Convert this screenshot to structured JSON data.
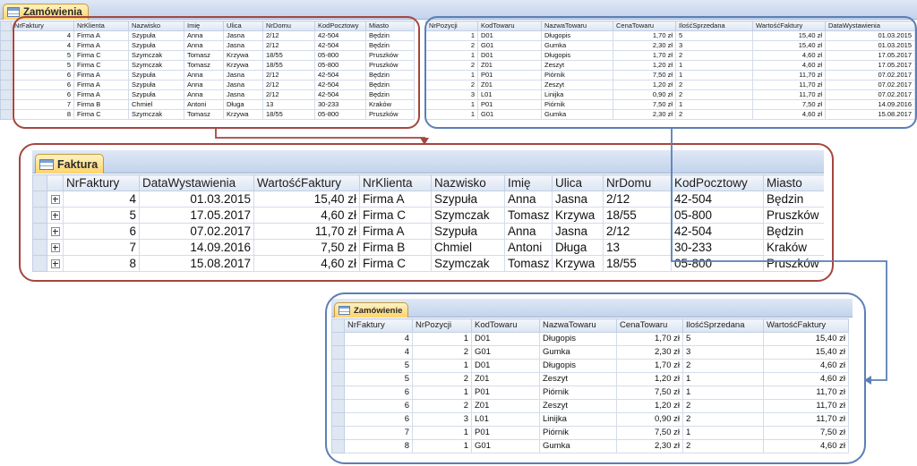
{
  "colors": {
    "red_outline": "#a5463f",
    "blue_outline": "#5b7fb5",
    "tab_fill": "#ffd36b",
    "header_fill": "#dbe5f3"
  },
  "icons": {
    "table": "table-icon",
    "expand": "plus-box-icon"
  },
  "orders_table": {
    "title": "Zamówienia",
    "columns": [
      "NrFaktury",
      "NrKlienta",
      "Nazwisko",
      "Imię",
      "Ulica",
      "NrDomu",
      "KodPocztowy",
      "Miasto"
    ],
    "rows": [
      [
        "4",
        "Firma A",
        "Szypuła",
        "Anna",
        "Jasna",
        "2/12",
        "42-504",
        "Będzin"
      ],
      [
        "4",
        "Firma A",
        "Szypuła",
        "Anna",
        "Jasna",
        "2/12",
        "42-504",
        "Będzin"
      ],
      [
        "5",
        "Firma C",
        "Szymczak",
        "Tomasz",
        "Krzywa",
        "18/55",
        "05-800",
        "Pruszków"
      ],
      [
        "5",
        "Firma C",
        "Szymczak",
        "Tomasz",
        "Krzywa",
        "18/55",
        "05-800",
        "Pruszków"
      ],
      [
        "6",
        "Firma A",
        "Szypuła",
        "Anna",
        "Jasna",
        "2/12",
        "42-504",
        "Będzin"
      ],
      [
        "6",
        "Firma A",
        "Szypuła",
        "Anna",
        "Jasna",
        "2/12",
        "42-504",
        "Będzin"
      ],
      [
        "6",
        "Firma A",
        "Szypuła",
        "Anna",
        "Jasna",
        "2/12",
        "42-504",
        "Będzin"
      ],
      [
        "7",
        "Firma B",
        "Chmiel",
        "Antoni",
        "Długa",
        "13",
        "30-233",
        "Kraków"
      ],
      [
        "8",
        "Firma C",
        "Szymczak",
        "Tomasz",
        "Krzywa",
        "18/55",
        "05-800",
        "Pruszków"
      ]
    ]
  },
  "positions_table": {
    "columns": [
      "NrPozycji",
      "KodTowaru",
      "NazwaTowaru",
      "CenaTowaru",
      "IlośćSprzedana",
      "WartośćFaktury",
      "DataWystawienia"
    ],
    "rows": [
      [
        "1",
        "D01",
        "Długopis",
        "1,70 zł",
        "5",
        "15,40 zł",
        "01.03.2015"
      ],
      [
        "2",
        "G01",
        "Gumka",
        "2,30 zł",
        "3",
        "15,40 zł",
        "01.03.2015"
      ],
      [
        "1",
        "D01",
        "Długopis",
        "1,70 zł",
        "2",
        "4,60 zł",
        "17.05.2017"
      ],
      [
        "2",
        "Z01",
        "Zeszyt",
        "1,20 zł",
        "1",
        "4,60 zł",
        "17.05.2017"
      ],
      [
        "1",
        "P01",
        "Piórnik",
        "7,50 zł",
        "1",
        "11,70 zł",
        "07.02.2017"
      ],
      [
        "2",
        "Z01",
        "Zeszyt",
        "1,20 zł",
        "2",
        "11,70 zł",
        "07.02.2017"
      ],
      [
        "3",
        "L01",
        "Linijka",
        "0,90 zł",
        "2",
        "11,70 zł",
        "07.02.2017"
      ],
      [
        "1",
        "P01",
        "Piórnik",
        "7,50 zł",
        "1",
        "7,50 zł",
        "14.09.2016"
      ],
      [
        "1",
        "G01",
        "Gumka",
        "2,30 zł",
        "2",
        "4,60 zł",
        "15.08.2017"
      ]
    ]
  },
  "invoice_table": {
    "title": "Faktura",
    "columns": [
      "NrFaktury",
      "DataWystawienia",
      "WartośćFaktury",
      "NrKlienta",
      "Nazwisko",
      "Imię",
      "Ulica",
      "NrDomu",
      "KodPocztowy",
      "Miasto"
    ],
    "rows": [
      [
        "4",
        "01.03.2015",
        "15,40 zł",
        "Firma A",
        "Szypuła",
        "Anna",
        "Jasna",
        "2/12",
        "42-504",
        "Będzin"
      ],
      [
        "5",
        "17.05.2017",
        "4,60 zł",
        "Firma C",
        "Szymczak",
        "Tomasz",
        "Krzywa",
        "18/55",
        "05-800",
        "Pruszków"
      ],
      [
        "6",
        "07.02.2017",
        "11,70 zł",
        "Firma A",
        "Szypuła",
        "Anna",
        "Jasna",
        "2/12",
        "42-504",
        "Będzin"
      ],
      [
        "7",
        "14.09.2016",
        "7,50 zł",
        "Firma B",
        "Chmiel",
        "Antoni",
        "Długa",
        "13",
        "30-233",
        "Kraków"
      ],
      [
        "8",
        "15.08.2017",
        "4,60 zł",
        "Firma C",
        "Szymczak",
        "Tomasz",
        "Krzywa",
        "18/55",
        "05-800",
        "Pruszków"
      ]
    ]
  },
  "order_table": {
    "title": "Zamówienie",
    "columns": [
      "NrFaktury",
      "NrPozycji",
      "KodTowaru",
      "NazwaTowaru",
      "CenaTowaru",
      "IlośćSprzedana",
      "WartośćFaktury"
    ],
    "rows": [
      [
        "4",
        "1",
        "D01",
        "Długopis",
        "1,70 zł",
        "5",
        "15,40 zł"
      ],
      [
        "4",
        "2",
        "G01",
        "Gumka",
        "2,30 zł",
        "3",
        "15,40 zł"
      ],
      [
        "5",
        "1",
        "D01",
        "Długopis",
        "1,70 zł",
        "2",
        "4,60 zł"
      ],
      [
        "5",
        "2",
        "Z01",
        "Zeszyt",
        "1,20 zł",
        "1",
        "4,60 zł"
      ],
      [
        "6",
        "1",
        "P01",
        "Piórnik",
        "7,50 zł",
        "1",
        "11,70 zł"
      ],
      [
        "6",
        "2",
        "Z01",
        "Zeszyt",
        "1,20 zł",
        "2",
        "11,70 zł"
      ],
      [
        "6",
        "3",
        "L01",
        "Linijka",
        "0,90 zł",
        "2",
        "11,70 zł"
      ],
      [
        "7",
        "1",
        "P01",
        "Piórnik",
        "7,50 zł",
        "1",
        "7,50 zł"
      ],
      [
        "8",
        "1",
        "G01",
        "Gumka",
        "2,30 zł",
        "2",
        "4,60 zł"
      ]
    ]
  }
}
